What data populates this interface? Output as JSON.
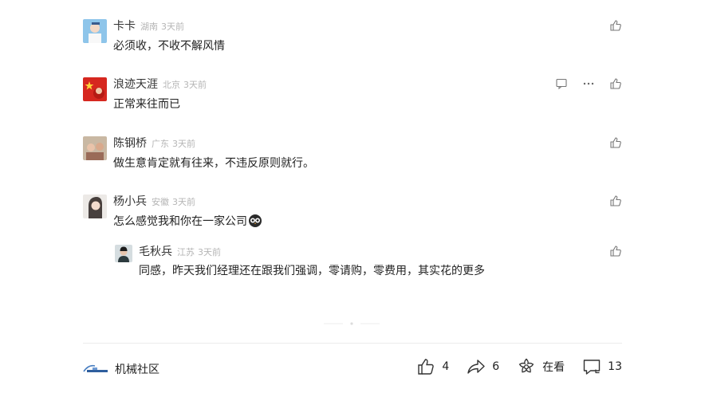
{
  "comments": [
    {
      "name": "卡卡",
      "location": "湖南",
      "time": "3天前",
      "text": "必须收，不收不解风情"
    },
    {
      "name": "浪迹天涯",
      "location": "北京",
      "time": "3天前",
      "text": "正常来往而已"
    },
    {
      "name": "陈钢桥",
      "location": "广东",
      "time": "3天前",
      "text": "做生意肯定就有往来，不违反原则就行。"
    },
    {
      "name": "杨小兵",
      "location": "安徽",
      "time": "3天前",
      "text": "怎么感觉我和你在一家公司"
    }
  ],
  "reply": {
    "name": "毛秋兵",
    "location": "江苏",
    "time": "3天前",
    "text": "同感，昨天我们经理还在跟我们强调，零请购，零费用，其实花的更多"
  },
  "footer": {
    "source": "机械社区",
    "like_count": "4",
    "share_count": "6",
    "watching_label": "在看",
    "comment_count": "13"
  },
  "icons": [
    "thumbs-up-icon",
    "chat-bubble-icon",
    "more-dots-icon",
    "share-arrow-icon",
    "flower-icon",
    "comment-icon",
    "owl-emoji-icon"
  ]
}
